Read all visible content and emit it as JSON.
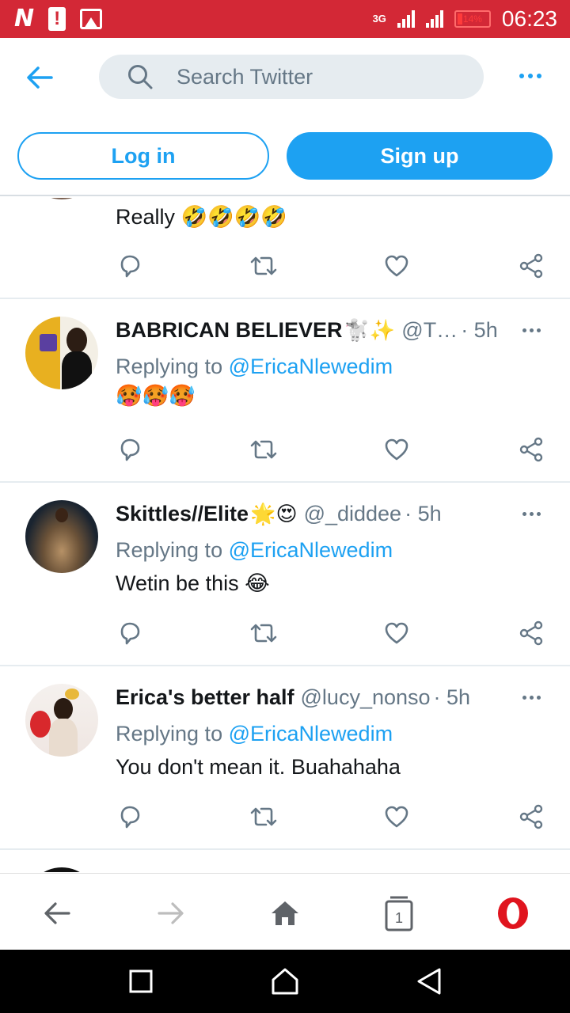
{
  "status_bar": {
    "carrier_glyph": "N",
    "alert_glyph": "!",
    "network_label": "3G",
    "battery": "14%",
    "time": "06:23"
  },
  "header": {
    "search_placeholder": "Search Twitter",
    "login_label": "Log in",
    "signup_label": "Sign up"
  },
  "colors": {
    "accent": "#1da1f2",
    "status_bar": "#d32836",
    "muted": "#657786"
  },
  "tweets": [
    {
      "name": "",
      "handle": "",
      "time": "",
      "replying_label": "",
      "mention": "",
      "text": "Really 🤣🤣🤣🤣"
    },
    {
      "name": "BABRICAN BELIEVER",
      "name_emoji": "🐩✨",
      "handle": "@T…",
      "time": "· 5h",
      "replying_label": "Replying to",
      "mention": "@EricaNlewedim",
      "text": "🥵🥵🥵"
    },
    {
      "name": "Skittles//Elite",
      "name_emoji": "🌟😍",
      "handle": "@_diddee",
      "time": "· 5h",
      "replying_label": "Replying to",
      "mention": "@EricaNlewedim",
      "text": "Wetin be this 😂"
    },
    {
      "name": "Erica's better half",
      "name_emoji": "",
      "handle": "@lucy_nonso",
      "time": "· 5h",
      "replying_label": "Replying to",
      "mention": "@EricaNlewedim",
      "text": "You don't mean it. Buahahaha"
    }
  ],
  "browser_nav": {
    "tab_count": "1"
  },
  "icons": [
    "back-arrow-icon",
    "search-icon",
    "more-icon",
    "reply-icon",
    "retweet-icon",
    "like-icon",
    "share-icon",
    "home-icon",
    "tabs-icon",
    "opera-icon"
  ]
}
